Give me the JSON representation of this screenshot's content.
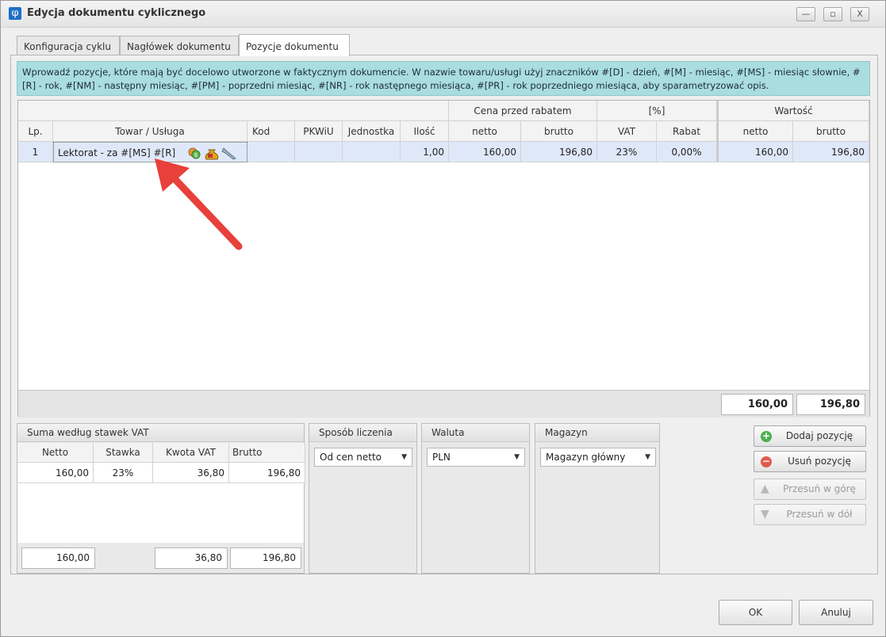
{
  "window": {
    "app_icon": "φ",
    "title": "Edycja dokumentu cyklicznego",
    "minimize": "—",
    "maximize": "▫",
    "close": "X"
  },
  "tabs": [
    "Konfiguracja cyklu",
    "Nagłówek dokumentu",
    "Pozycje dokumentu"
  ],
  "info_text": "Wprowadź pozycje, które mają być docelowo utworzone w faktycznym dokumencie. W nazwie towaru/usługi użyj znaczników #[D] - dzień, #[M] - miesiąc, #[MS] - miesiąc słownie, #[R] - rok, #[NM] - następny miesiąc, #[PM] - poprzedni miesiąc, #[NR] - rok następnego miesiąca, #[PR] - rok poprzedniego miesiąca, aby sparametryzować opis.",
  "grid": {
    "group_headers": {
      "cena": "Cena przed rabatem",
      "percent": "[%]",
      "wartosc": "Wartość"
    },
    "columns": {
      "lp": "Lp.",
      "towar": "Towar / Usługa",
      "kod": "Kod",
      "pkwiu": "PKWiU",
      "jednostka": "Jednostka",
      "ilosc": "Ilość",
      "netto": "netto",
      "brutto": "brutto",
      "vat": "VAT",
      "rabat": "Rabat",
      "w_netto": "netto",
      "w_brutto": "brutto"
    },
    "rows": [
      {
        "lp": "1",
        "towar": "Lektorat - za #[MS] #[R]",
        "kod": "",
        "pkwiu": "",
        "jednostka": "",
        "ilosc": "1,00",
        "netto": "160,00",
        "brutto": "196,80",
        "vat": "23%",
        "rabat": "0,00%",
        "w_netto": "160,00",
        "w_brutto": "196,80"
      }
    ],
    "totals": {
      "netto": "160,00",
      "brutto": "196,80"
    },
    "row_icons": [
      "coins-icon",
      "money-bag-icon",
      "wrench-icon"
    ]
  },
  "vat_summary": {
    "title": "Suma według stawek VAT",
    "columns": [
      "Netto",
      "Stawka",
      "Kwota VAT",
      "Brutto"
    ],
    "rows": [
      {
        "netto": "160,00",
        "stawka": "23%",
        "kwota": "36,80",
        "brutto": "196,80"
      }
    ],
    "totals": {
      "netto": "160,00",
      "kwota": "36,80",
      "brutto": "196,80"
    }
  },
  "sposob": {
    "title": "Sposób liczenia",
    "value": "Od cen netto"
  },
  "waluta": {
    "title": "Waluta",
    "value": "PLN"
  },
  "magazyn": {
    "title": "Magazyn",
    "value": "Magazyn główny"
  },
  "actions": {
    "add": "Dodaj pozycję",
    "remove": "Usuń pozycję",
    "up": "Przesuń w górę",
    "down": "Przesuń w dół"
  },
  "footer": {
    "ok": "OK",
    "cancel": "Anuluj"
  },
  "colors": {
    "info_bg": "#a9dde0",
    "row_selected": "#dfe8f8",
    "arrow": "#e8403a",
    "add_icon": "#4caf50",
    "remove_icon": "#e05a4f"
  }
}
